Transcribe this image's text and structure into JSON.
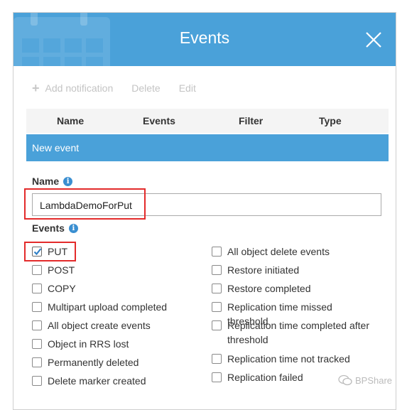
{
  "dialog": {
    "title": "Events"
  },
  "toolbar": {
    "add_label": "Add notification",
    "delete_label": "Delete",
    "edit_label": "Edit"
  },
  "table": {
    "headers": [
      "Name",
      "Events",
      "Filter",
      "Type"
    ],
    "row": "New event"
  },
  "form": {
    "name_label": "Name",
    "name_value": "LambdaDemoForPut",
    "events_label": "Events"
  },
  "events_left": [
    {
      "label": "PUT",
      "checked": true
    },
    {
      "label": "POST",
      "checked": false
    },
    {
      "label": "COPY",
      "checked": false
    },
    {
      "label": "Multipart upload completed",
      "checked": false
    },
    {
      "label": "All object create events",
      "checked": false
    },
    {
      "label": "Object in RRS lost",
      "checked": false
    },
    {
      "label": "Permanently deleted",
      "checked": false
    },
    {
      "label": "Delete marker created",
      "checked": false
    }
  ],
  "events_right": [
    {
      "label": "All object delete events",
      "checked": false
    },
    {
      "label": "Restore initiated",
      "checked": false
    },
    {
      "label": "Restore completed",
      "checked": false
    },
    {
      "label": "Replication time missed threshold",
      "checked": false
    },
    {
      "label": "Replication time completed after threshold",
      "checked": false
    },
    {
      "label": "Replication time not tracked",
      "checked": false
    },
    {
      "label": "Replication failed",
      "checked": false
    }
  ],
  "watermark": {
    "text": "BPShare"
  },
  "colors": {
    "header": "#4aa1d9",
    "highlight": "#e32b2b",
    "check": "#2f7fc6"
  }
}
